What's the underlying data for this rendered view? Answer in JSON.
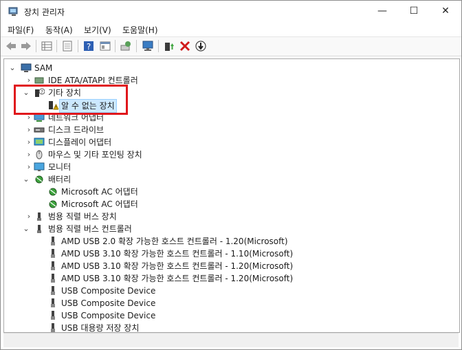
{
  "window": {
    "title": "장치 관리자",
    "min_glyph": "—",
    "max_glyph": "☐",
    "close_glyph": "✕"
  },
  "menu": [
    "파일(F)",
    "동작(A)",
    "보기(V)",
    "도움말(H)"
  ],
  "toolbar": {
    "icons": [
      "back-icon",
      "forward-icon",
      "properties-grid-icon",
      "show-hide-icon",
      "help-icon",
      "view-icon",
      "scan-icon",
      "monitor-icon",
      "update-driver-icon",
      "uninstall-icon",
      "disable-icon"
    ]
  },
  "tree": {
    "root": "SAM",
    "items": [
      {
        "label": "IDE ATA/ATAPI 컨트롤러",
        "expand": "›",
        "icon": "ide-controller-icon"
      },
      {
        "label": "기타 장치",
        "expand": "⌄",
        "icon": "unknown-device-category-icon"
      },
      {
        "label": "알 수 없는 장치",
        "icon": "warning-device-icon",
        "selected": true
      },
      {
        "label": "네트워크 어댑터",
        "expand": "›",
        "icon": "network-adapter-icon"
      },
      {
        "label": "디스크 드라이브",
        "expand": "›",
        "icon": "disk-drive-icon"
      },
      {
        "label": "디스플레이 어댑터",
        "expand": "›",
        "icon": "display-adapter-icon"
      },
      {
        "label": "마우스 및 기타 포인팅 장치",
        "expand": "›",
        "icon": "mouse-icon"
      },
      {
        "label": "모니터",
        "expand": "›",
        "icon": "monitor-icon"
      },
      {
        "label": "배터리",
        "expand": "⌄",
        "icon": "battery-icon"
      },
      {
        "label": "Microsoft AC 어댑터",
        "icon": "battery-icon"
      },
      {
        "label": "Microsoft AC 어댑터",
        "icon": "battery-icon"
      },
      {
        "label": "범용 직렬 버스 장치",
        "expand": "›",
        "icon": "usb-device-icon"
      },
      {
        "label": "범용 직렬 버스 컨트롤러",
        "expand": "⌄",
        "icon": "usb-controller-icon"
      },
      {
        "label": "AMD USB 2.0 확장 가능한 호스트 컨트롤러 - 1.20(Microsoft)",
        "icon": "usb-plug-icon"
      },
      {
        "label": "AMD USB 3.10 확장 가능한 호스트 컨트롤러 - 1.10(Microsoft)",
        "icon": "usb-plug-icon"
      },
      {
        "label": "AMD USB 3.10 확장 가능한 호스트 컨트롤러 - 1.20(Microsoft)",
        "icon": "usb-plug-icon"
      },
      {
        "label": "AMD USB 3.10 확장 가능한 호스트 컨트롤러 - 1.20(Microsoft)",
        "icon": "usb-plug-icon"
      },
      {
        "label": "USB Composite Device",
        "icon": "usb-plug-icon"
      },
      {
        "label": "USB Composite Device",
        "icon": "usb-plug-icon"
      },
      {
        "label": "USB Composite Device",
        "icon": "usb-plug-icon"
      },
      {
        "label": "USB 대용량 저장 장치",
        "icon": "usb-plug-icon"
      }
    ]
  },
  "colors": {
    "highlight_border": "#e0161b",
    "selection": "#cce8ff",
    "accent": "#0078d4"
  }
}
